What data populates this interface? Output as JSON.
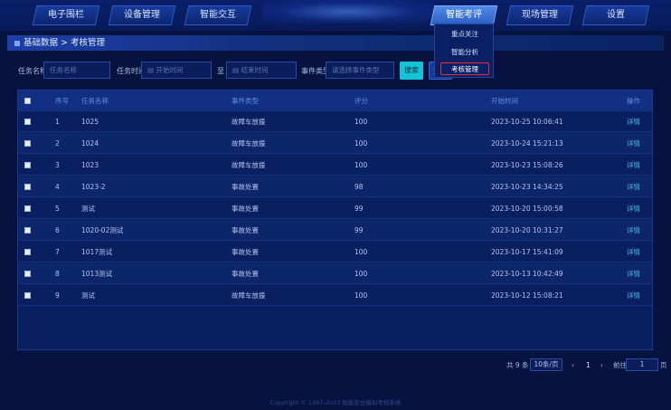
{
  "nav": {
    "tabs": [
      {
        "label": "电子围栏"
      },
      {
        "label": "设备管理"
      },
      {
        "label": "智能交互"
      },
      {
        "label": "智能考评"
      },
      {
        "label": "现场管理"
      },
      {
        "label": "设置"
      }
    ],
    "active_index": 3
  },
  "dropdown": {
    "items": [
      "重点关注",
      "智能分析",
      "考核管理"
    ],
    "selected": "考核管理"
  },
  "breadcrumb": {
    "text": "基础数据 > 考核管理"
  },
  "filters": {
    "task_name_label": "任务名称",
    "task_name_placeholder": "任务名称",
    "task_time_label": "任务时间",
    "start_placeholder": "开始时间",
    "to_label": "至",
    "end_placeholder": "结束时间",
    "event_type_label": "事件类型",
    "event_type_placeholder": "请选择事件类型",
    "search_label": "搜索",
    "reset_label": "重置"
  },
  "table": {
    "headers": [
      "序号",
      "任务名称",
      "事件类型",
      "评分",
      "开始时间",
      "操作"
    ],
    "rows": [
      {
        "no": "1",
        "name": "1025",
        "type": "故障车放援",
        "score": "100",
        "time": "2023-10-25 10:06:41",
        "action": "详情"
      },
      {
        "no": "2",
        "name": "1024",
        "type": "故障车放援",
        "score": "100",
        "time": "2023-10-24 15:21:13",
        "action": "详情"
      },
      {
        "no": "3",
        "name": "1023",
        "type": "故障车放援",
        "score": "100",
        "time": "2023-10-23 15:08:26",
        "action": "详情"
      },
      {
        "no": "4",
        "name": "1023-2",
        "type": "事故处置",
        "score": "98",
        "time": "2023-10-23 14:34:25",
        "action": "详情"
      },
      {
        "no": "5",
        "name": "测试",
        "type": "事故处置",
        "score": "99",
        "time": "2023-10-20 15:00:58",
        "action": "详情"
      },
      {
        "no": "6",
        "name": "1020-02测试",
        "type": "事故处置",
        "score": "99",
        "time": "2023-10-20 10:31:27",
        "action": "详情"
      },
      {
        "no": "7",
        "name": "1017测试",
        "type": "事故处置",
        "score": "100",
        "time": "2023-10-17 15:41:09",
        "action": "详情"
      },
      {
        "no": "8",
        "name": "1013测试",
        "type": "事故处置",
        "score": "100",
        "time": "2023-10-13 10:42:49",
        "action": "详情"
      },
      {
        "no": "9",
        "name": "测试",
        "type": "故障车放援",
        "score": "100",
        "time": "2023-10-12 15:08:21",
        "action": "详情"
      }
    ]
  },
  "pagination": {
    "total_text": "共 9 条",
    "page_size": "10条/页",
    "prev": "‹",
    "current_page": "1",
    "next": "›",
    "goto_label": "前往",
    "goto_value": "1",
    "page_suffix": "页"
  },
  "footer": {
    "text": "Copyright © 1997-2023 智能安全模拟考核系统"
  },
  "colors": {
    "background": "#06123f",
    "accent": "#15c3d6",
    "highlight_border": "#e0303a",
    "link": "#43c0e8"
  }
}
